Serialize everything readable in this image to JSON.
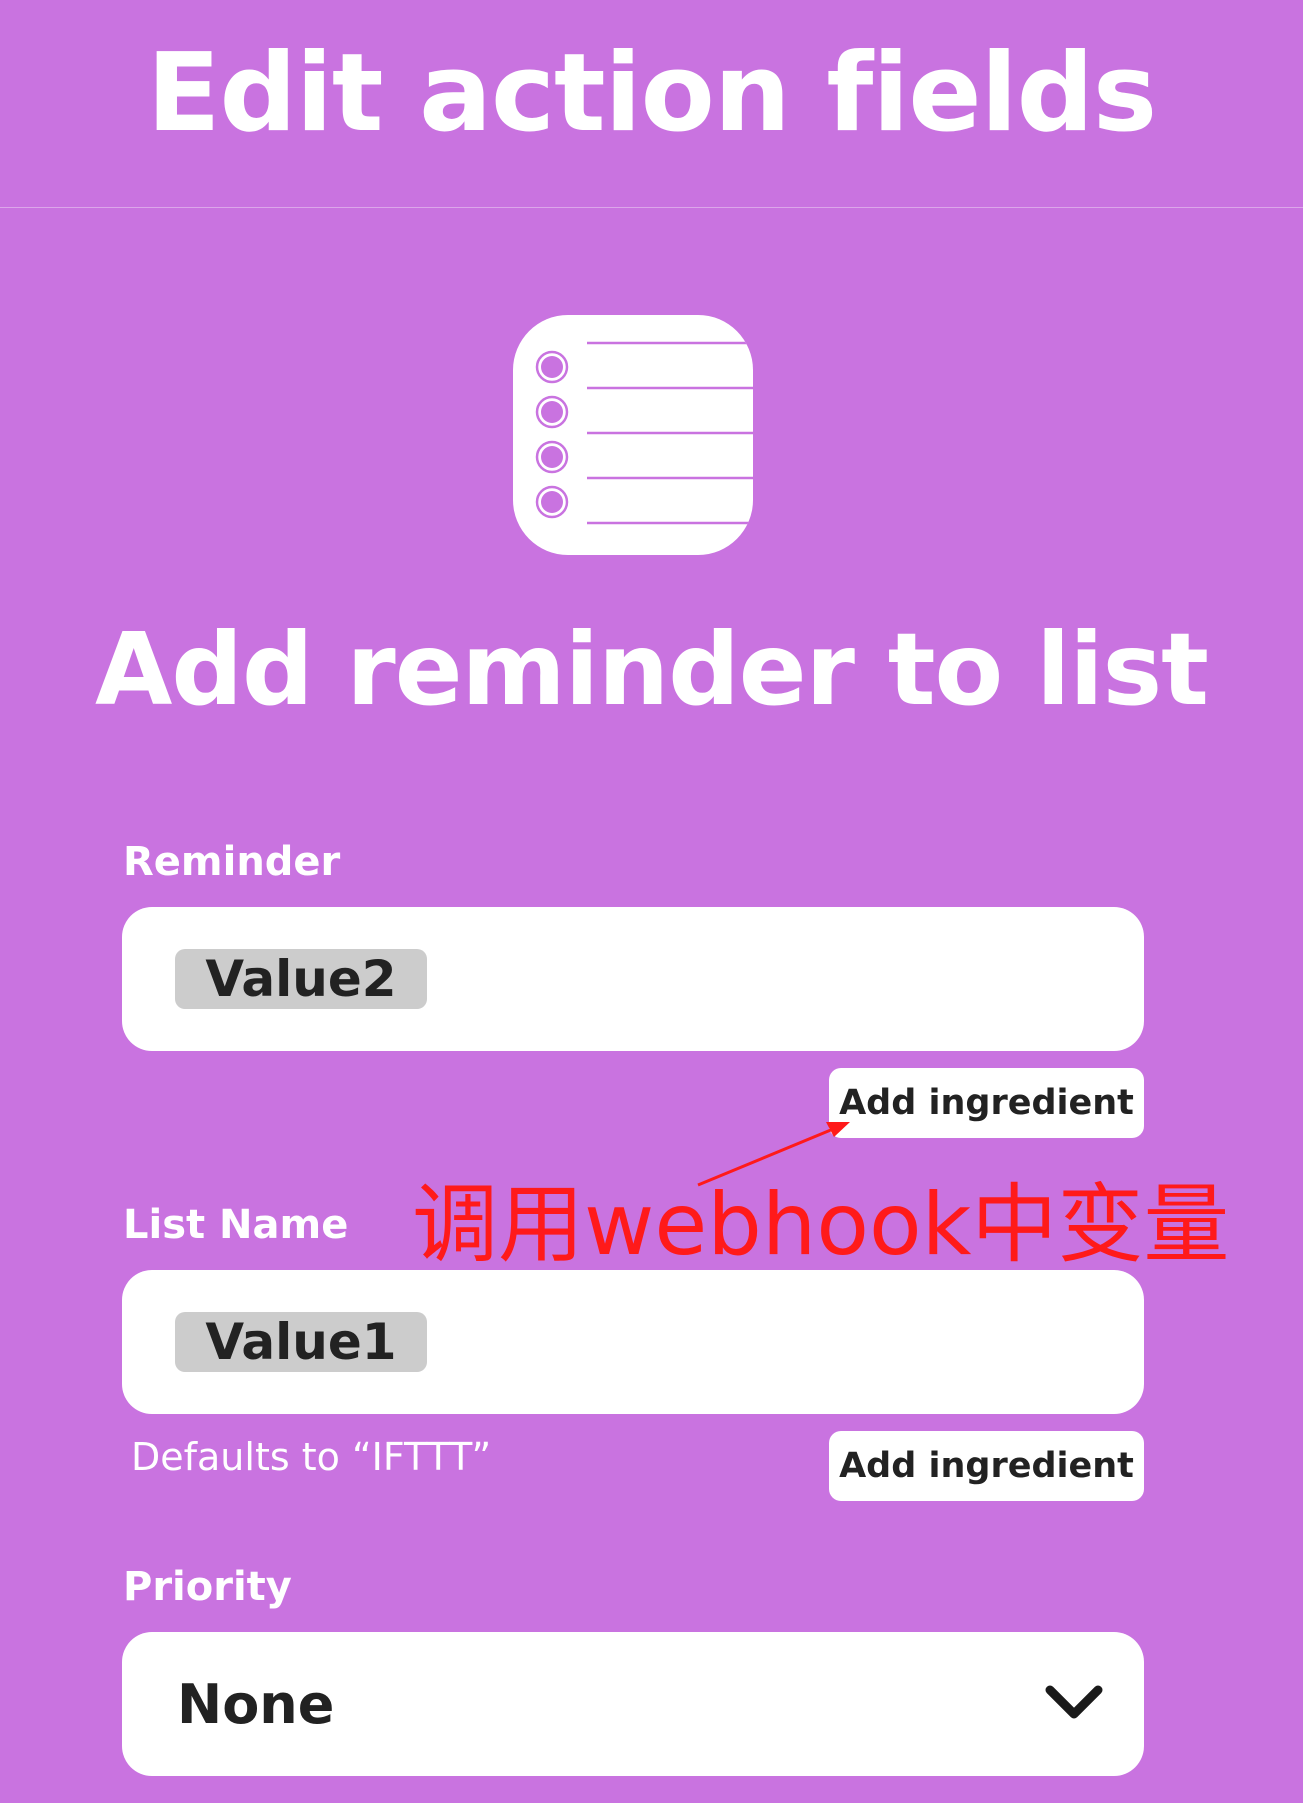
{
  "header": {
    "title": "Edit action fields"
  },
  "service": {
    "icon": "reminders-list-icon",
    "action_title": "Add reminder to list"
  },
  "fields": {
    "reminder": {
      "label": "Reminder",
      "ingredient": "Value2",
      "add_ingredient_label": "Add ingredient"
    },
    "list_name": {
      "label": "List Name",
      "ingredient": "Value1",
      "helper": "Defaults to “IFTTT”",
      "add_ingredient_label": "Add ingredient"
    },
    "priority": {
      "label": "Priority",
      "selected": "None",
      "icon": "chevron-down-icon"
    }
  },
  "annotation": {
    "text": "调用webhook中变量",
    "color": "#ff1a1a"
  },
  "colors": {
    "background": "#c973e0",
    "field_background": "#ffffff",
    "pill_background": "#cccccc"
  }
}
